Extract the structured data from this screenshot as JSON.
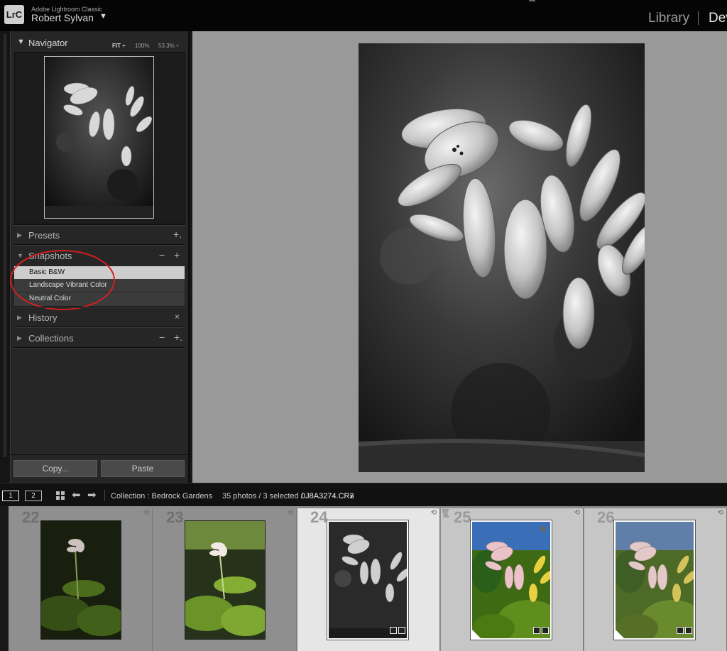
{
  "app": {
    "logo": "LrC",
    "name": "Adobe Lightroom Classic",
    "user": "Robert Sylvan",
    "user_caret": "▼"
  },
  "modules": {
    "library": "Library",
    "develop": "Dev"
  },
  "navigator": {
    "title": "Navigator",
    "zoom_fit": "FIT ÷",
    "zoom_100": "100%",
    "zoom_custom": "53.3% ÷"
  },
  "panels": {
    "presets": {
      "title": "Presets",
      "action": "+."
    },
    "snapshots": {
      "title": "Snapshots",
      "minus": "−",
      "plus": "+",
      "items": [
        "Basic B&W",
        "Landscape Vibrant Color",
        "Neutral Color"
      ],
      "selected_index": 0
    },
    "history": {
      "title": "History",
      "action": "×"
    },
    "collections": {
      "title": "Collections",
      "minus": "−",
      "plus": "+."
    }
  },
  "buttons": {
    "copy": "Copy...",
    "paste": "Paste"
  },
  "filmstrip_bar": {
    "monitor1": "1",
    "monitor2": "2",
    "collection": "Collection : Bedrock Gardens",
    "count": "35 photos / 3 selected /",
    "filename": "0J8A3274.CR3",
    "filename_caret": "▾"
  },
  "filmstrip": {
    "cells": [
      {
        "num": "22",
        "state": "normal",
        "tone": "color-dark"
      },
      {
        "num": "23",
        "state": "normal",
        "tone": "color-bright"
      },
      {
        "num": "24",
        "state": "current",
        "tone": "bw"
      },
      {
        "num": "25",
        "state": "selected",
        "tone": "color-vibrant"
      },
      {
        "num": "26",
        "state": "selected",
        "tone": "color-neutral"
      }
    ]
  },
  "icons": {
    "nav_collapse": "triangle-down-icon",
    "section_expand": "triangle-right-icon",
    "grid": "grid-icon",
    "prev": "arrow-left-icon",
    "next": "arrow-right-icon",
    "rotate": "rotate-icon",
    "flag": "flag-icon"
  },
  "colors": {
    "annotation_circle": "#d42020",
    "snapshot_selected": "#cdcdcd",
    "canvas_bg": "#999999"
  }
}
